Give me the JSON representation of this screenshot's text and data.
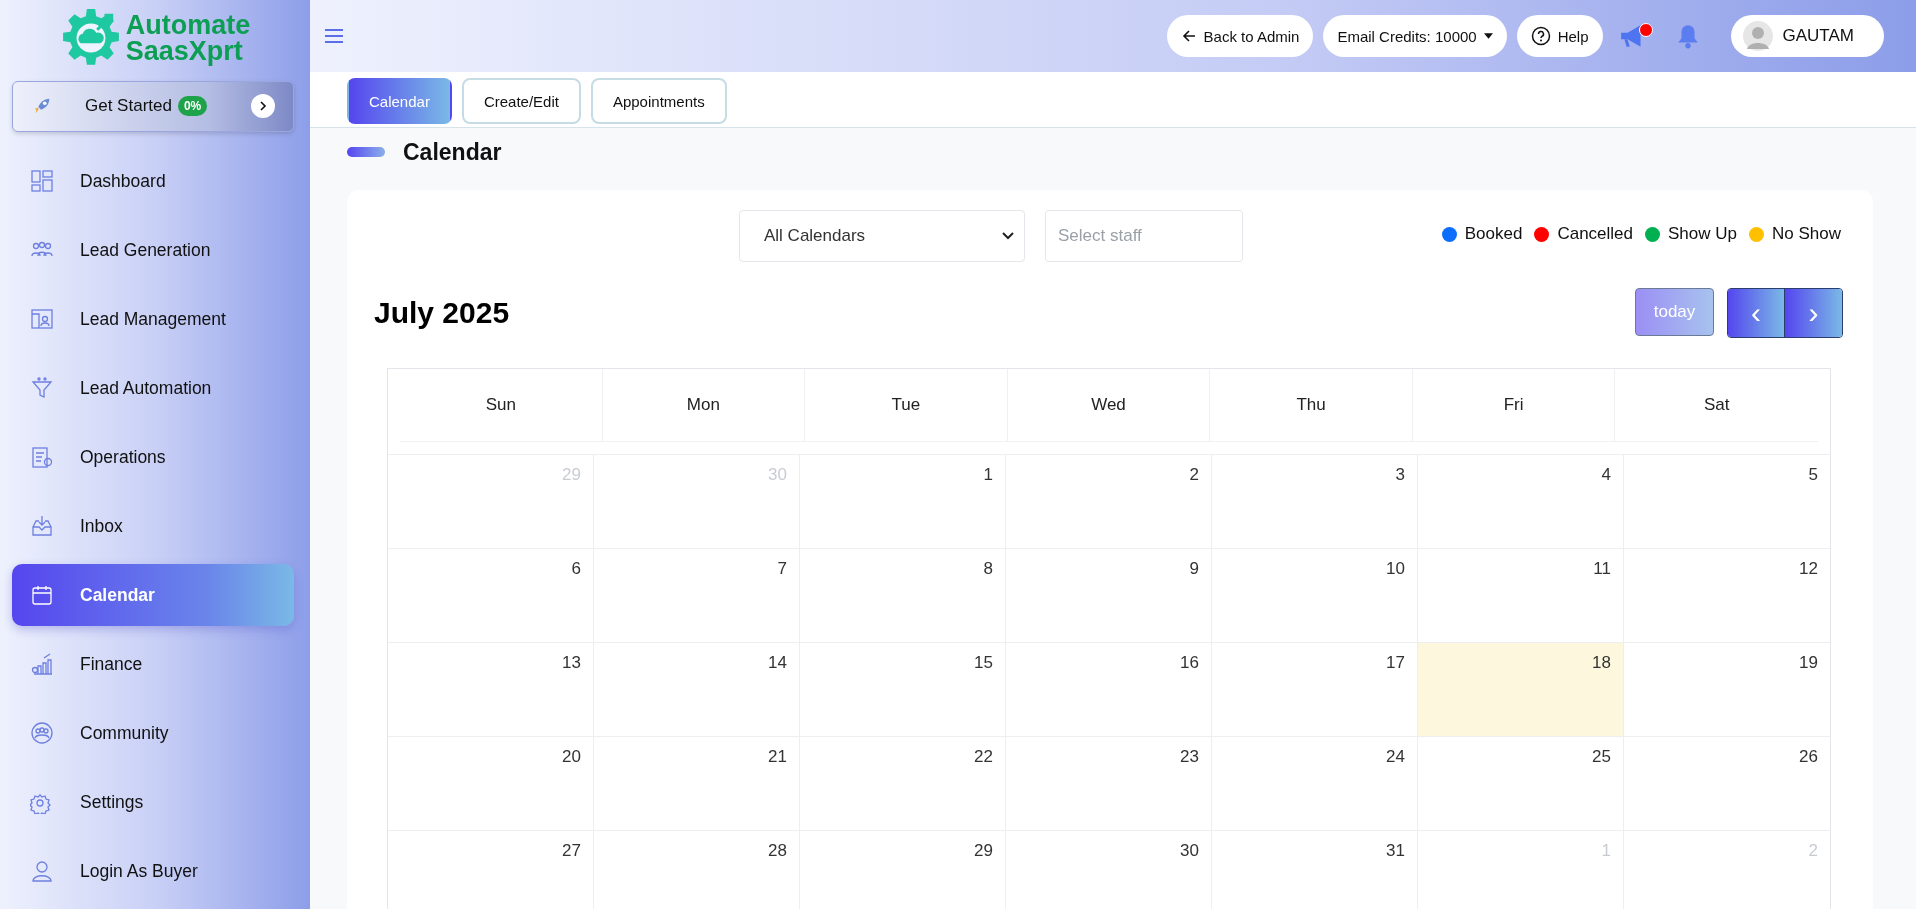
{
  "logo": {
    "line1": "Automate",
    "line2": "SaasXprt"
  },
  "get_started": {
    "label": "Get Started",
    "badge": "0%"
  },
  "sidebar": {
    "items": [
      {
        "label": "Dashboard",
        "selected": false
      },
      {
        "label": "Lead Generation",
        "selected": false
      },
      {
        "label": "Lead Management",
        "selected": false
      },
      {
        "label": "Lead Automation",
        "selected": false
      },
      {
        "label": "Operations",
        "selected": false
      },
      {
        "label": "Inbox",
        "selected": false
      },
      {
        "label": "Calendar",
        "selected": true
      },
      {
        "label": "Finance",
        "selected": false
      },
      {
        "label": "Community",
        "selected": false
      },
      {
        "label": "Settings",
        "selected": false
      },
      {
        "label": "Login As Buyer",
        "selected": false
      }
    ]
  },
  "header": {
    "back": "Back to Admin",
    "credits": "Email Credits: 10000",
    "help": "Help",
    "announcement_unread": true,
    "user": "GAUTAM"
  },
  "tabs": [
    {
      "label": "Calendar",
      "selected": true
    },
    {
      "label": "Create/Edit",
      "selected": false
    },
    {
      "label": "Appointments",
      "selected": false
    }
  ],
  "page_title": "Calendar",
  "filters": {
    "calendar": "All Calendars",
    "staff_placeholder": "Select staff"
  },
  "legend": [
    {
      "label": "Booked",
      "color": "#0d6efd"
    },
    {
      "label": "Cancelled",
      "color": "#ff0000"
    },
    {
      "label": "Show Up",
      "color": "#00b050"
    },
    {
      "label": "No Show",
      "color": "#ffc000"
    }
  ],
  "calendar": {
    "title": "July 2025",
    "today_button": "today",
    "prev": "‹",
    "next": "›",
    "weekdays": [
      "Sun",
      "Mon",
      "Tue",
      "Wed",
      "Thu",
      "Fri",
      "Sat"
    ],
    "weeks": [
      [
        {
          "day": "29",
          "other_month": true,
          "today": false
        },
        {
          "day": "30",
          "other_month": true,
          "today": false
        },
        {
          "day": "1",
          "other_month": false,
          "today": false
        },
        {
          "day": "2",
          "other_month": false,
          "today": false
        },
        {
          "day": "3",
          "other_month": false,
          "today": false
        },
        {
          "day": "4",
          "other_month": false,
          "today": false
        },
        {
          "day": "5",
          "other_month": false,
          "today": false
        }
      ],
      [
        {
          "day": "6",
          "other_month": false,
          "today": false
        },
        {
          "day": "7",
          "other_month": false,
          "today": false
        },
        {
          "day": "8",
          "other_month": false,
          "today": false
        },
        {
          "day": "9",
          "other_month": false,
          "today": false
        },
        {
          "day": "10",
          "other_month": false,
          "today": false
        },
        {
          "day": "11",
          "other_month": false,
          "today": false
        },
        {
          "day": "12",
          "other_month": false,
          "today": false
        }
      ],
      [
        {
          "day": "13",
          "other_month": false,
          "today": false
        },
        {
          "day": "14",
          "other_month": false,
          "today": false
        },
        {
          "day": "15",
          "other_month": false,
          "today": false
        },
        {
          "day": "16",
          "other_month": false,
          "today": false
        },
        {
          "day": "17",
          "other_month": false,
          "today": false
        },
        {
          "day": "18",
          "other_month": false,
          "today": true
        },
        {
          "day": "19",
          "other_month": false,
          "today": false
        }
      ],
      [
        {
          "day": "20",
          "other_month": false,
          "today": false
        },
        {
          "day": "21",
          "other_month": false,
          "today": false
        },
        {
          "day": "22",
          "other_month": false,
          "today": false
        },
        {
          "day": "23",
          "other_month": false,
          "today": false
        },
        {
          "day": "24",
          "other_month": false,
          "today": false
        },
        {
          "day": "25",
          "other_month": false,
          "today": false
        },
        {
          "day": "26",
          "other_month": false,
          "today": false
        }
      ],
      [
        {
          "day": "27",
          "other_month": false,
          "today": false
        },
        {
          "day": "28",
          "other_month": false,
          "today": false
        },
        {
          "day": "29",
          "other_month": false,
          "today": false
        },
        {
          "day": "30",
          "other_month": false,
          "today": false
        },
        {
          "day": "31",
          "other_month": false,
          "today": false
        },
        {
          "day": "1",
          "other_month": true,
          "today": false
        },
        {
          "day": "2",
          "other_month": true,
          "today": false
        }
      ]
    ]
  }
}
